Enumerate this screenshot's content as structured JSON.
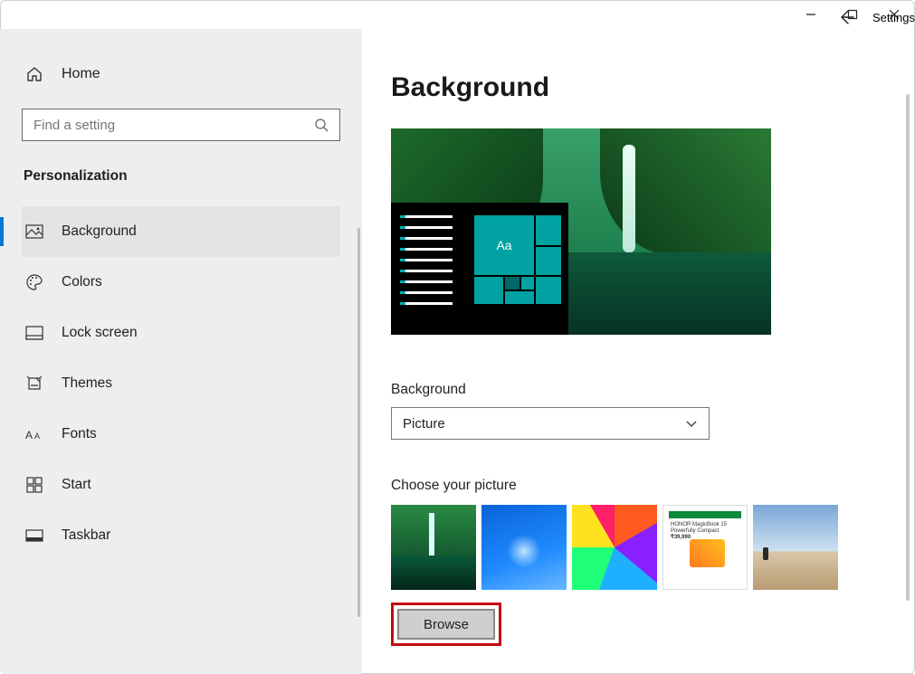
{
  "app": {
    "title": "Settings"
  },
  "sidebar": {
    "home": "Home",
    "search_placeholder": "Find a setting",
    "category": "Personalization",
    "items": [
      {
        "label": "Background",
        "icon": "picture-icon",
        "selected": true
      },
      {
        "label": "Colors",
        "icon": "palette-icon"
      },
      {
        "label": "Lock screen",
        "icon": "lockscreen-icon"
      },
      {
        "label": "Themes",
        "icon": "themes-icon"
      },
      {
        "label": "Fonts",
        "icon": "fonts-icon"
      },
      {
        "label": "Start",
        "icon": "start-icon"
      },
      {
        "label": "Taskbar",
        "icon": "taskbar-icon"
      }
    ]
  },
  "page": {
    "title": "Background",
    "preview_sample_text": "Aa",
    "bg_label": "Background",
    "bg_value": "Picture",
    "choose_label": "Choose your picture",
    "browse": "Browse",
    "thumb4": {
      "line1": "HONOR MagicBook 15",
      "line2": "Powerfully Compact",
      "line3": "₹39,990"
    }
  }
}
